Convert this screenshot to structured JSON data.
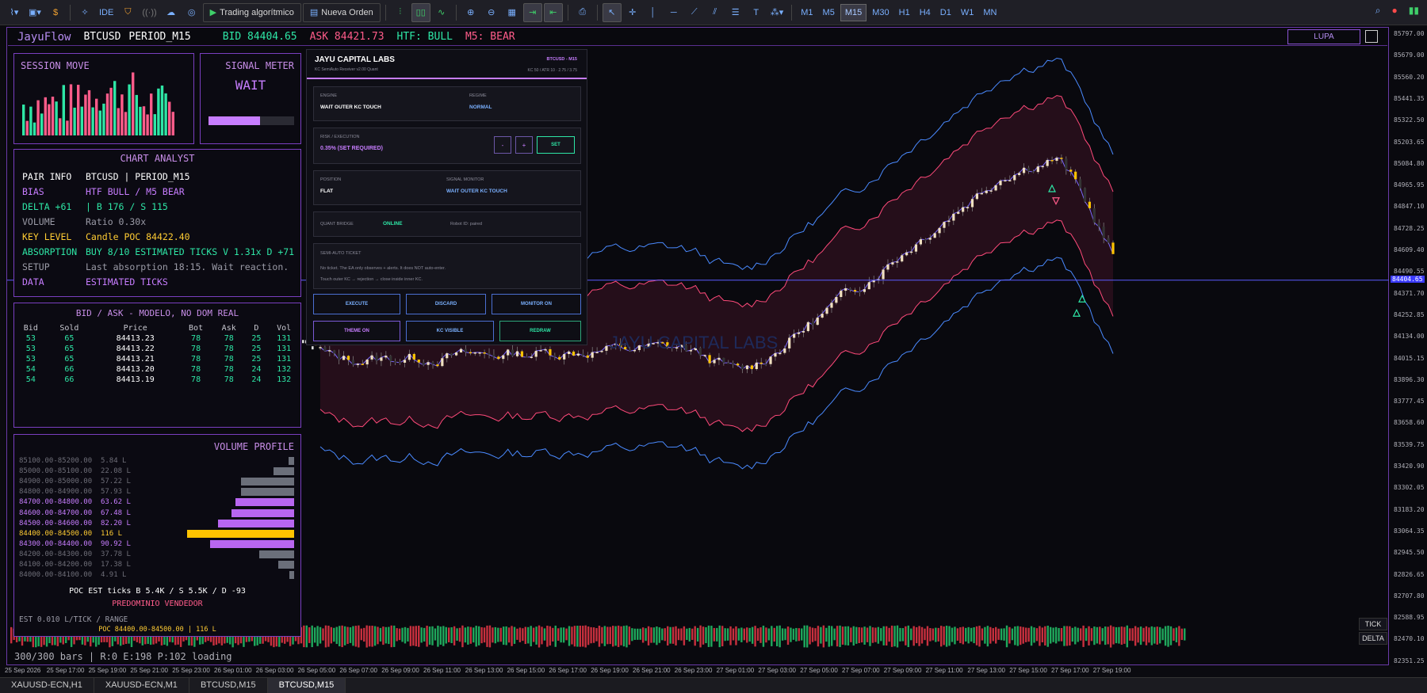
{
  "toolbar": {
    "algo_label": "Trading algorítmico",
    "order_label": "Nueva Orden",
    "ide_label": "IDE",
    "timeframes": [
      "M1",
      "M5",
      "M15",
      "M30",
      "H1",
      "H4",
      "D1",
      "W1",
      "MN"
    ],
    "active_timeframe": "M15"
  },
  "header": {
    "brand": "JayuFlow",
    "symbol": "BTCUSD",
    "period": "PERIOD_M15",
    "bid": "BID 84404.65",
    "ask": "ASK 84421.73",
    "htf": "HTF: BULL",
    "m5": "M5: BEAR",
    "lupa": "LUPA"
  },
  "session_move": {
    "title": "SESSION MOVE"
  },
  "signal_meter": {
    "title": "SIGNAL METER",
    "state": "WAIT",
    "level": 0.6
  },
  "chart_analyst": {
    "title": "CHART ANALYST",
    "rows": [
      {
        "k": "PAIR INFO",
        "v": "BTCUSD | PERIOD_M15",
        "color": "#ffffff"
      },
      {
        "k": "BIAS",
        "v": "HTF BULL / M5 BEAR",
        "color": "#c77dff"
      },
      {
        "k": "DELTA +61",
        "v": "| B 176 / S 115",
        "color": "#2ee6a6"
      },
      {
        "k": "VOLUME",
        "v": "Ratio 0.30x",
        "color": "#9a9aa6"
      },
      {
        "k": "KEY LEVEL",
        "v": "Candle POC 84422.40",
        "color": "#ffcc33"
      },
      {
        "k": "ABSORPTION",
        "v": "BUY 8/10 ESTIMATED TICKS V 1.31x D +71",
        "color": "#2ee6a6"
      },
      {
        "k": "SETUP",
        "v": "Last absorption 18:15. Wait reaction.",
        "color": "#9a9aa6"
      },
      {
        "k": "DATA",
        "v": "ESTIMATED TICKS",
        "color": "#c77dff"
      }
    ]
  },
  "bid_ask": {
    "title": "BID / ASK - MODELO, NO DOM REAL",
    "headers": [
      "Bid",
      "Sold",
      "Price",
      "Bot",
      "Ask",
      "D",
      "Vol"
    ],
    "rows": [
      [
        "53",
        "65",
        "84413.23",
        "78",
        "78",
        "25",
        "131"
      ],
      [
        "53",
        "65",
        "84413.22",
        "78",
        "78",
        "25",
        "131"
      ],
      [
        "53",
        "65",
        "84413.21",
        "78",
        "78",
        "25",
        "131"
      ],
      [
        "54",
        "66",
        "84413.20",
        "78",
        "78",
        "24",
        "132"
      ],
      [
        "54",
        "66",
        "84413.19",
        "78",
        "78",
        "24",
        "132"
      ]
    ]
  },
  "volume_profile": {
    "title": "VOLUME PROFILE",
    "rows": [
      {
        "range": "85100.00-85200.00",
        "vol": "5.84 L",
        "value": 5.84,
        "kind": "low"
      },
      {
        "range": "85000.00-85100.00",
        "vol": "22.08 L",
        "value": 22.08,
        "kind": "low"
      },
      {
        "range": "84900.00-85000.00",
        "vol": "57.22 L",
        "value": 57.22,
        "kind": "low"
      },
      {
        "range": "84800.00-84900.00",
        "vol": "57.93 L",
        "value": 57.93,
        "kind": "low"
      },
      {
        "range": "84700.00-84800.00",
        "vol": "63.62 L",
        "value": 63.62,
        "kind": "high"
      },
      {
        "range": "84600.00-84700.00",
        "vol": "67.48 L",
        "value": 67.48,
        "kind": "high"
      },
      {
        "range": "84500.00-84600.00",
        "vol": "82.20 L",
        "value": 82.2,
        "kind": "high"
      },
      {
        "range": "84400.00-84500.00",
        "vol": "116 L",
        "value": 116,
        "kind": "poc"
      },
      {
        "range": "84300.00-84400.00",
        "vol": "90.92 L",
        "value": 90.92,
        "kind": "high"
      },
      {
        "range": "84200.00-84300.00",
        "vol": "37.78 L",
        "value": 37.78,
        "kind": "low"
      },
      {
        "range": "84100.00-84200.00",
        "vol": "17.38 L",
        "value": 17.38,
        "kind": "low"
      },
      {
        "range": "84000.00-84100.00",
        "vol": "4.91 L",
        "value": 4.91,
        "kind": "low"
      }
    ],
    "poc_ticks": "POC EST ticks B 5.4K / S 5.5K / D -93",
    "predominio": "PREDOMINIO VENDEDOR",
    "est": "EST 0.010 L/TICK / RANGE",
    "poc_line": "POC 84400.00-84500.00 | 116 L"
  },
  "jayu": {
    "title": "JAYU CAPITAL LABS",
    "subtitle": "KC SemiAuto Receiver v2.00 Quant",
    "badge": "BTCUSD - M15",
    "info": "KC 50 / ATR 10 · 2.75 / 3.75",
    "engine_lbl": "ENGINE",
    "engine_val": "WAIT OUTER KC TOUCH",
    "regime_lbl": "REGIME",
    "regime_val": "NORMAL",
    "risk_lbl": "RISK / EXECUTION",
    "risk_val": "0.35% (SET REQUIRED)",
    "minus": "-",
    "plus": "+",
    "set": "SET",
    "position_lbl": "POSITION",
    "position_val": "FLAT",
    "monitor_lbl": "SIGNAL MONITOR",
    "monitor_val": "WAIT OUTER KC TOUCH",
    "bridge_lbl": "QUANT BRIDGE",
    "bridge_val": "ONLINE",
    "robot_id": "Robot ID: paired",
    "ticket_lbl": "SEMI-AUTO TICKET",
    "ticket_l1": "No ticket. The EA only observes + alerts. It does NOT auto-enter.",
    "ticket_l2": "Touch outer KC → rejection → close inside inner KC.",
    "btn_execute": "EXECUTE",
    "btn_discard": "DISCARD",
    "btn_monitor": "MONITOR ON",
    "btn_theme": "THEME ON",
    "btn_kc": "KC VISIBLE",
    "btn_redraw": "REDRAW"
  },
  "watermark": "JAYU CAPITAL LABS",
  "status": {
    "text": "300/300 bars | R:0 E:198 P:102 loading",
    "tick": "TICK",
    "delta": "DELTA"
  },
  "price_axis": [
    "85797.00",
    "85679.00",
    "85560.20",
    "85441.35",
    "85322.50",
    "85203.65",
    "85084.80",
    "84965.95",
    "84847.10",
    "84728.25",
    "84609.40",
    "84490.55",
    "84371.70",
    "84252.85",
    "84134.00",
    "84015.15",
    "83896.30",
    "83777.45",
    "83658.60",
    "83539.75",
    "83420.90",
    "83302.05",
    "83183.20",
    "83064.35",
    "82945.50",
    "82826.65",
    "82707.80",
    "82588.95",
    "82470.10",
    "82351.25"
  ],
  "current_price": "84404.65",
  "time_axis": [
    "25 Sep 2026",
    "25 Sep 17:00",
    "25 Sep 19:00",
    "25 Sep 21:00",
    "25 Sep 23:00",
    "26 Sep 01:00",
    "26 Sep 03:00",
    "26 Sep 05:00",
    "26 Sep 07:00",
    "26 Sep 09:00",
    "26 Sep 11:00",
    "26 Sep 13:00",
    "26 Sep 15:00",
    "26 Sep 17:00",
    "26 Sep 19:00",
    "26 Sep 21:00",
    "26 Sep 23:00",
    "27 Sep 01:00",
    "27 Sep 03:00",
    "27 Sep 05:00",
    "27 Sep 07:00",
    "27 Sep 09:00",
    "27 Sep 11:00",
    "27 Sep 13:00",
    "27 Sep 15:00",
    "27 Sep 17:00",
    "27 Sep 19:00"
  ],
  "tabs": [
    "XAUUSD-ECN,H1",
    "XAUUSD-ECN,M1",
    "BTCUSD,M15",
    "BTCUSD,M15"
  ],
  "active_tab": 3
}
